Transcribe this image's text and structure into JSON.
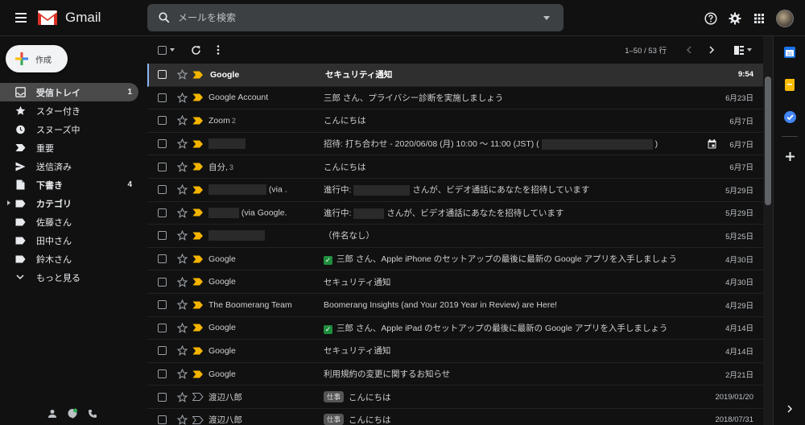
{
  "app": {
    "name": "Gmail"
  },
  "search": {
    "placeholder": "メールを検索"
  },
  "compose": {
    "label": "作成"
  },
  "nav": [
    {
      "label": "受信トレイ",
      "count": "1",
      "icon": "inbox-icon",
      "active": true,
      "bold": true
    },
    {
      "label": "スター付き",
      "count": "",
      "icon": "star-icon"
    },
    {
      "label": "スヌーズ中",
      "count": "",
      "icon": "snooze-icon"
    },
    {
      "label": "重要",
      "count": "",
      "icon": "important-icon"
    },
    {
      "label": "送信済み",
      "count": "",
      "icon": "send-icon"
    },
    {
      "label": "下書き",
      "count": "4",
      "icon": "draft-icon",
      "bold": true
    },
    {
      "label": "カテゴリ",
      "count": "",
      "icon": "label-icon",
      "bold": true,
      "expandable": true
    },
    {
      "label": "佐藤さん",
      "count": "",
      "icon": "label-icon"
    },
    {
      "label": "田中さん",
      "count": "",
      "icon": "label-icon"
    },
    {
      "label": "鈴木さん",
      "count": "",
      "icon": "label-icon"
    },
    {
      "label": "もっと見る",
      "count": "",
      "icon": "chevron-down-icon"
    }
  ],
  "toolbar": {
    "pager": "1–50 / 53 行"
  },
  "emails": [
    {
      "sender": "Google",
      "count": "",
      "subject": "セキュリティ通知",
      "date": "9:54",
      "unread": true,
      "first": true
    },
    {
      "sender": "Google Account",
      "count": "",
      "subject": "三郎 さん、プライバシー診断を実施しましょう",
      "date": "6月23日"
    },
    {
      "sender": "Zoom",
      "count": "2",
      "subject": "こんにちは",
      "date": "6月7日"
    },
    {
      "sender": "",
      "count": "",
      "subject": "招待: 打ち合わせ - 2020/06/08 (月) 10:00 ～ 11:00 (JST) (",
      "subject_tail": ")",
      "date": "6月7日",
      "calendar": true
    },
    {
      "sender": "自分,",
      "count": "3",
      "subject": "こんにちは",
      "date": "6月7日"
    },
    {
      "sender": "",
      "sender_tail": "(via .",
      "count": "",
      "subject": "進行中:",
      "subject_tail": "さんが、ビデオ通話にあなたを招待しています",
      "date": "5月29日"
    },
    {
      "sender": "",
      "sender_tail": "(via Google.",
      "count": "",
      "subject": "進行中:",
      "subject_tail": "さんが、ビデオ通話にあなたを招待しています",
      "date": "5月29日"
    },
    {
      "sender": "",
      "count": "",
      "subject": "（件名なし）",
      "date": "5月25日"
    },
    {
      "sender": "Google",
      "count": "",
      "subject": "三郎 さん、Apple iPhone のセットアップの最後に最新の Google アプリを入手しましょう",
      "date": "4月30日",
      "check": true
    },
    {
      "sender": "Google",
      "count": "",
      "subject": "セキュリティ通知",
      "date": "4月30日"
    },
    {
      "sender": "The Boomerang Team",
      "count": "",
      "subject": "Boomerang Insights (and Your 2019 Year in Review) are Here!",
      "date": "4月29日"
    },
    {
      "sender": "Google",
      "count": "",
      "subject": "三郎 さん、Apple iPad のセットアップの最後に最新の Google アプリを入手しましょう",
      "date": "4月14日",
      "check": true
    },
    {
      "sender": "Google",
      "count": "",
      "subject": "セキュリティ通知",
      "date": "4月14日"
    },
    {
      "sender": "Google",
      "count": "",
      "subject": "利用規約の変更に関するお知らせ",
      "date": "2月21日"
    },
    {
      "sender": "渡辺八郎",
      "count": "",
      "subject": "こんにちは",
      "label": "仕事",
      "date": "2019/01/20",
      "notimp": true
    },
    {
      "sender": "渡辺八郎",
      "count": "",
      "subject": "こんにちは",
      "label": "仕事",
      "date": "2018/07/31",
      "notimp": true
    }
  ],
  "colors": {
    "important": "#f4b400",
    "accent": "#8ab4f8"
  }
}
